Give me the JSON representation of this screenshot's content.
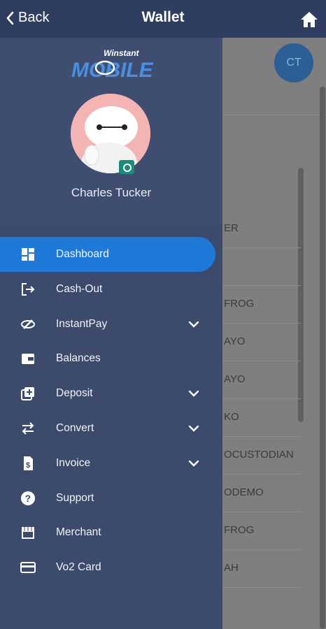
{
  "header": {
    "back_label": "Back",
    "title": "Wallet"
  },
  "brand": {
    "top": "Winstant",
    "bottom": "MOBILE"
  },
  "profile": {
    "name": "Charles Tucker"
  },
  "menu": [
    {
      "label": "Dashboard",
      "icon": "dashboard-icon",
      "active": true
    },
    {
      "label": "Cash-Out",
      "icon": "cash-out-icon"
    },
    {
      "label": "InstantPay",
      "icon": "instantpay-icon",
      "expand": true
    },
    {
      "label": "Balances",
      "icon": "wallet-icon"
    },
    {
      "label": "Deposit",
      "icon": "deposit-icon",
      "expand": true
    },
    {
      "label": "Convert",
      "icon": "convert-icon",
      "expand": true
    },
    {
      "label": "Invoice",
      "icon": "invoice-icon",
      "expand": true
    },
    {
      "label": "Support",
      "icon": "help-icon"
    },
    {
      "label": "Merchant",
      "icon": "store-icon"
    },
    {
      "label": "Vo2 Card",
      "icon": "card-icon"
    }
  ],
  "background": {
    "avatar_initials": "CT",
    "rows": [
      "ER",
      "",
      "FROG",
      "AYO",
      "AYO",
      "KO",
      "OCUSTODIAN",
      "ODEMO",
      "FROG",
      "AH"
    ]
  },
  "colors": {
    "drawer": "#3e4d70",
    "header": "#2f3e60",
    "active": "#1f79d9"
  }
}
